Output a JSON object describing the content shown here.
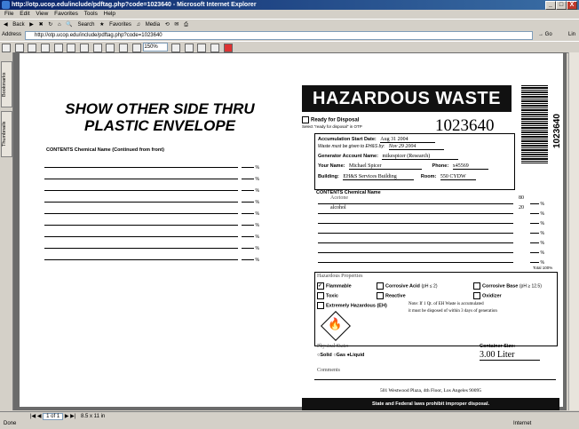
{
  "window": {
    "title": "http://otp.ucop.edu/include/pdftag.php?code=1023640 - Microsoft Internet Explorer",
    "minimize": "_",
    "maximize": "□",
    "close": "X"
  },
  "menu": [
    "File",
    "Edit",
    "View",
    "Favorites",
    "Tools",
    "Help"
  ],
  "toolbar": {
    "back": "Back",
    "search": "Search",
    "favorites": "Favorites",
    "media": "Media"
  },
  "address": {
    "label": "Address",
    "url": "http://otp.ucop.edu/include/pdftag.php?code=1023640",
    "go": "Go",
    "links": "Lin"
  },
  "pdf": {
    "zoom": "150%",
    "page_indicator": "1 of 1",
    "page_size": "8.5 x 11 in",
    "tabs": [
      "Bookmarks",
      "Thumbnails"
    ]
  },
  "left_side": {
    "title_line1": "SHOW OTHER SIDE THRU",
    "title_line2": "PLASTIC ENVELOPE",
    "contents_label": "CONTENTS Chemical Name (Continued from front)",
    "percent_sign": "%"
  },
  "form": {
    "header": "HAZARDOUS WASTE",
    "barcode_number": "1023640",
    "tag_number": "1023640",
    "ready_label": "Ready for Disposal",
    "ready_sub": "Select \"ready for disposal\" in OTP",
    "accum_label": "Accumulation Start Date:",
    "accum_value": "Aug 31 2004",
    "given_label": "Waste must be given to EH&S by:",
    "given_value": "Nov 29 2004",
    "generator_label": "Generator Account Name:",
    "generator_value": "mikespicer (Research)",
    "your_name_label": "Your Name:",
    "your_name_value": "Michael Spicer",
    "phone_label": "Phone:",
    "phone_value": "x45569",
    "building_label": "Building:",
    "building_value": "EH&S Services Building",
    "room_label": "Room:",
    "room_value": "550 CYDW",
    "contents_label": "CONTENTS Chemical Name",
    "chemicals": [
      {
        "name": "Acetone",
        "pct": "80"
      },
      {
        "name": "alcohol",
        "pct": "20"
      }
    ],
    "total_label": "Total 100%",
    "hazardous_props_label": "Hazardous Properties",
    "props": {
      "flammable": "Flammable",
      "corrosive_acid": "Corrosive Acid",
      "corrosive_acid_ph": "(pH ≤ 2)",
      "corrosive_base": "Corrosive Base",
      "corrosive_base_ph": "(pH ≥ 12.5)",
      "toxic": "Toxic",
      "reactive": "Reactive",
      "oxidizer": "Oxidizer",
      "eh": "Extremely Hazardous (EH)",
      "eh_note1": "Note: If 1 Qt. of EH Waste is accumulated",
      "eh_note2": "it must be disposed of within 3 days of generation"
    },
    "flammable_checked": true,
    "physical_state_label": "Physical State:",
    "states": {
      "solid": "Solid",
      "gas": "Gas",
      "liquid": "Liquid"
    },
    "selected_state": "Liquid",
    "container_label": "Container Size:",
    "container_value": "3.00 Liter",
    "comments_label": "Comments",
    "address_line": "501 Westwood Plaza, 4th Floor, Los Angeles 90095",
    "footer": "State and Federal laws prohibit improper disposal."
  },
  "status": {
    "text": "Done",
    "zone": "Internet"
  }
}
